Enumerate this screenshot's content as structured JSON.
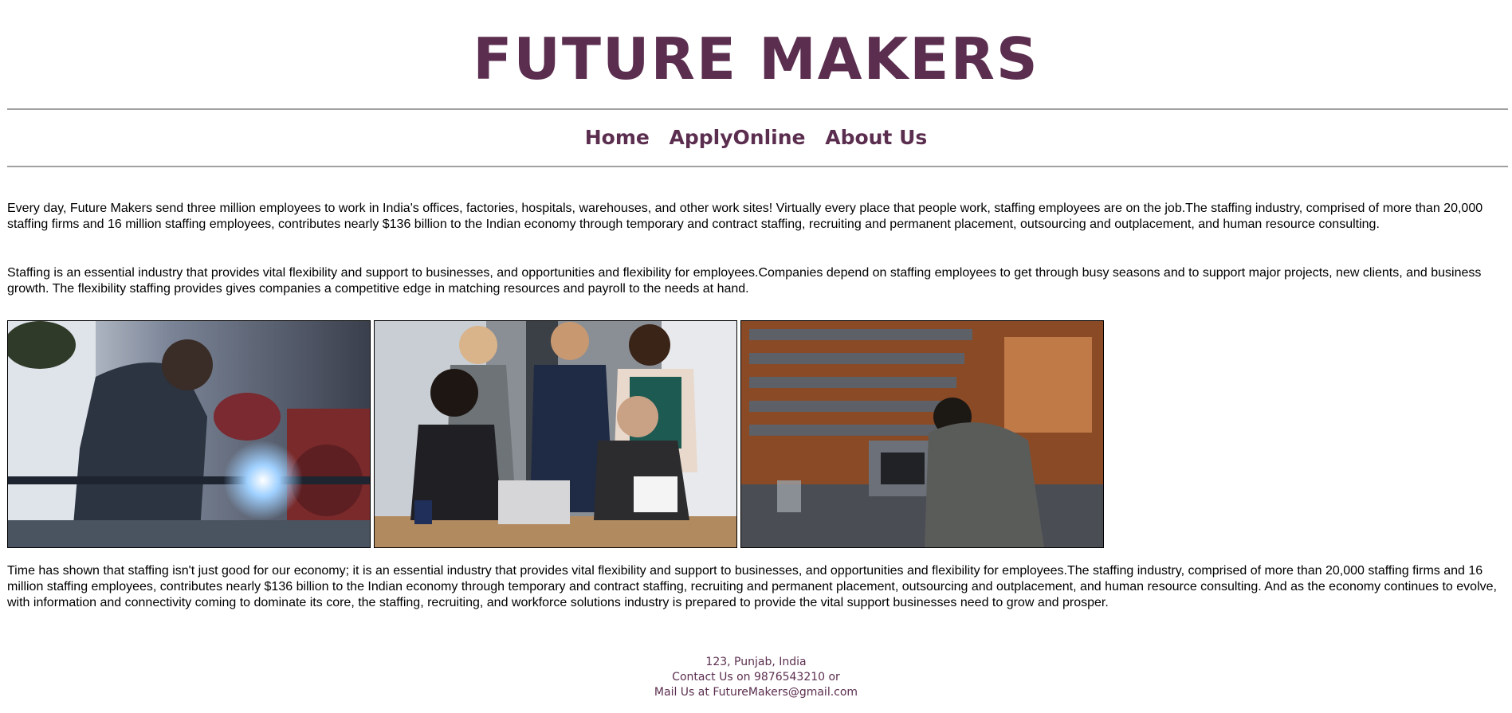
{
  "header": {
    "title": "FUTURE MAKERS"
  },
  "nav": {
    "items": [
      {
        "label": "Home"
      },
      {
        "label": "ApplyOnline"
      },
      {
        "label": "About Us"
      }
    ]
  },
  "content": {
    "paragraph1": "Every day, Future Makers send three million employees to work in India's offices, factories, hospitals, warehouses, and other work sites! Virtually every place that people work, staffing employees are on the job.The staffing industry, comprised of more than 20,000 staffing firms and 16 million staffing employees, contributes nearly $136 billion to the Indian economy through temporary and contract staffing, recruiting and permanent placement, outsourcing and outplacement, and human resource consulting.",
    "paragraph2": "Staffing is an essential industry that provides vital flexibility and support to businesses, and opportunities and flexibility for employees.Companies depend on staffing employees to get through busy seasons and to support major projects, new clients, and business growth. The flexibility staffing provides gives companies a competitive edge in matching resources and payroll to the needs at hand.",
    "paragraph3": "Time has shown that staffing isn't just good for our economy; it is an essential industry that provides vital flexibility and support to businesses, and opportunities and flexibility for employees.The staffing industry, comprised of more than 20,000 staffing firms and 16 million staffing employees, contributes nearly $136 billion to the Indian economy through temporary and contract staffing, recruiting and permanent placement, outsourcing and outplacement, and human resource consulting. And as the economy continues to evolve, with information and connectivity coming to dominate its core, the staffing, recruiting, and workforce solutions industry is prepared to provide the vital support businesses need to grow and prosper."
  },
  "gallery": {
    "images": [
      {
        "icon": "welder-photo"
      },
      {
        "icon": "office-team-photo"
      },
      {
        "icon": "workshop-photo"
      }
    ]
  },
  "footer": {
    "address": "123, Punjab, India",
    "contact": "Contact Us on 9876543210 or",
    "mail": "Mail Us at FutureMakers@gmail.com"
  },
  "colors": {
    "brand": "#5b2e4f",
    "rule": "#a0a0a0"
  }
}
